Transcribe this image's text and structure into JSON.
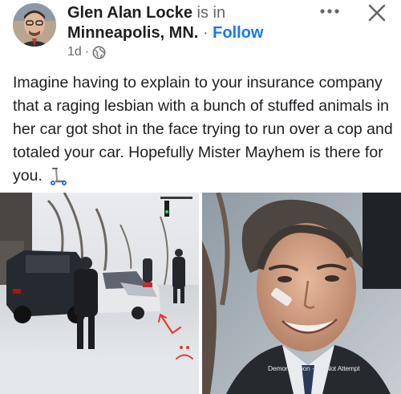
{
  "post": {
    "author_name": "Glen Alan Locke",
    "author_verb": " is in",
    "location": "Minneapolis, MN.",
    "separator": " · ",
    "follow_label": "Follow",
    "timestamp": "1d",
    "meta_separator": " · ",
    "text": "Imagine having to explain to your insurance company that a raging lesbian with a bunch of stuffed animals in her car got shot in the face trying to run over a cop and totaled your car. Hopefully Mister Mayhem is there for you."
  },
  "header": {
    "more_icon": "more-horizontal-icon",
    "close_icon": "close-icon"
  },
  "icons": {
    "privacy": "globe-icon",
    "emoji": "kick-scooter-emoji"
  },
  "photos": {
    "right_watermark": "Demonstration · Do Not Attempt"
  },
  "colors": {
    "follow": "#1877f2",
    "secondary_text": "#65676b",
    "primary_text": "#1c1e21"
  }
}
